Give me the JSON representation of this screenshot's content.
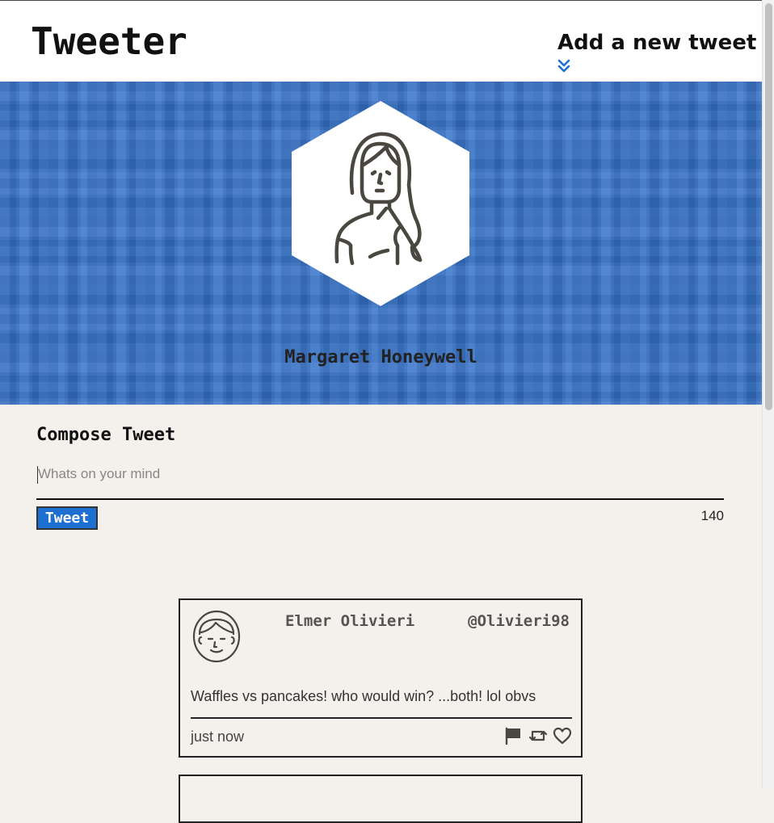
{
  "nav": {
    "brand": "Tweeter",
    "compose_toggle_label": "Add a new tweet",
    "compose_toggle_icon": "chevron-double-down-icon",
    "accent_color": "#1d6fd1"
  },
  "profile": {
    "name": "Margaret Honeywell",
    "avatar_icon": "woman-avatar-icon",
    "header_color": "#3573c9"
  },
  "compose": {
    "title": "Compose Tweet",
    "placeholder": "Whats on your mind",
    "value": "",
    "button_label": "Tweet",
    "char_counter": "140"
  },
  "tweets": [
    {
      "author": "Elmer Olivieri",
      "handle": "@Olivieri98",
      "avatar_icon": "man-avatar-icon",
      "content": "Waffles vs pancakes! who would win? ...both! lol obvs",
      "time": "just now",
      "actions": [
        "flag-icon",
        "retweet-icon",
        "heart-icon"
      ]
    }
  ]
}
